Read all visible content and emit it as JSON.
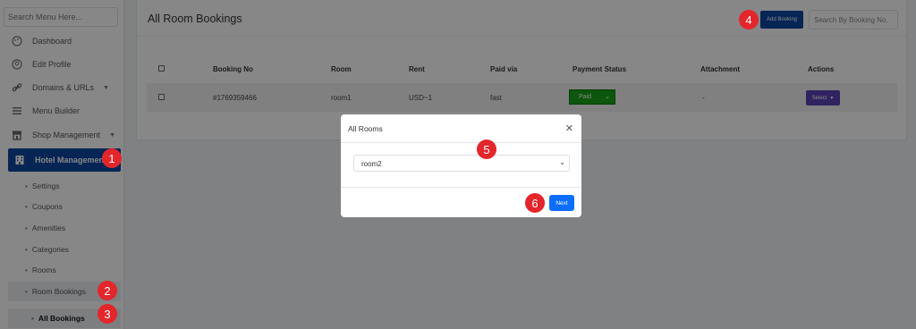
{
  "sidebar": {
    "search_placeholder": "Search Menu Here...",
    "items": [
      {
        "label": "Dashboard",
        "icon": "palette-icon"
      },
      {
        "label": "Edit Profile",
        "icon": "user-circle-icon"
      },
      {
        "label": "Domains & URLs",
        "icon": "link-icon",
        "has_caret": true
      },
      {
        "label": "Menu Builder",
        "icon": "menu-icon"
      },
      {
        "label": "Shop Management",
        "icon": "shop-icon",
        "has_caret": true
      },
      {
        "label": "Hotel Management",
        "icon": "hotel-icon",
        "active": true
      }
    ],
    "subitems": [
      "Settings",
      "Coupons",
      "Amenities",
      "Categories",
      "Rooms",
      "Room Bookings"
    ],
    "subsubitems": [
      "All Bookings"
    ]
  },
  "main": {
    "title": "All Room Bookings",
    "add_button": "Add Booking",
    "search_placeholder": "Search By Booking No.",
    "table": {
      "headers": [
        "Booking No",
        "Room",
        "Rent",
        "Paid via",
        "Payment Status",
        "Attachment",
        "Actions"
      ],
      "rows": [
        {
          "booking_no": "#1769359466",
          "room": "room1",
          "rent": "USD~1",
          "paid_via": "fast",
          "payment_status": "Paid",
          "attachment": "-",
          "actions": "Select"
        }
      ]
    }
  },
  "modal": {
    "title": "All Rooms",
    "selected_room": "room2",
    "next_button": "Next"
  },
  "markers": [
    "1",
    "2",
    "3",
    "4",
    "5",
    "6"
  ],
  "colors": {
    "primary": "#0d47a1",
    "next": "#0d6efd",
    "paid": "#1aa21a",
    "select": "#5b43b3",
    "marker": "#e3262b"
  }
}
